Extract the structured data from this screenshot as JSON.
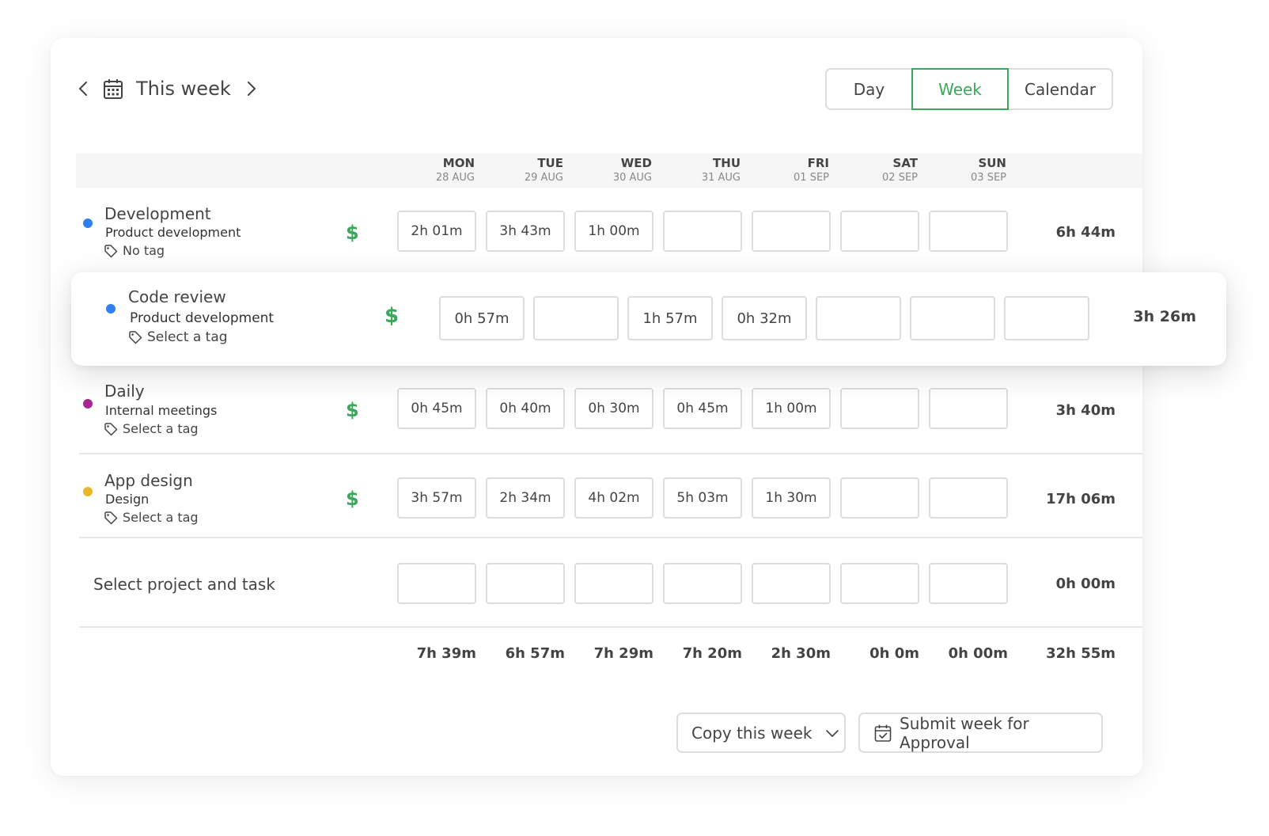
{
  "header": {
    "title": "This week",
    "views": {
      "day": "Day",
      "week": "Week",
      "calendar": "Calendar",
      "active": "week"
    }
  },
  "days": [
    {
      "name": "MON",
      "date": "28 AUG"
    },
    {
      "name": "TUE",
      "date": "29 AUG"
    },
    {
      "name": "WED",
      "date": "30 AUG"
    },
    {
      "name": "THU",
      "date": "31 AUG"
    },
    {
      "name": "FRI",
      "date": "01 SEP"
    },
    {
      "name": "SAT",
      "date": "02 SEP"
    },
    {
      "name": "SUN",
      "date": "03 SEP"
    }
  ],
  "rows": [
    {
      "task": "Development",
      "project": "Product development",
      "tag": "No tag",
      "color": "#2f7ff0",
      "billable": "$",
      "cells": [
        "2h 01m",
        "3h 43m",
        "1h 00m",
        "",
        "",
        "",
        ""
      ],
      "total": "6h 44m"
    },
    {
      "task": "Code review",
      "project": "Product development",
      "tag": "Select a tag",
      "color": "#2f7ff0",
      "billable": "$",
      "cells": [
        "0h 57m",
        "",
        "1h 57m",
        "0h 32m",
        "",
        "",
        ""
      ],
      "total": "3h 26m"
    },
    {
      "task": "Daily",
      "project": "Internal meetings",
      "tag": "Select a tag",
      "color": "#a6278f",
      "billable": "$",
      "cells": [
        "0h 45m",
        "0h 40m",
        "0h 30m",
        "0h 45m",
        "1h 00m",
        "",
        ""
      ],
      "total": "3h 40m"
    },
    {
      "task": "App design",
      "project": "Design",
      "tag": "Select a tag",
      "color": "#e8b82a",
      "billable": "$",
      "cells": [
        "3h 57m",
        "2h 34m",
        "4h 02m",
        "5h 03m",
        "1h 30m",
        "",
        ""
      ],
      "total": "17h 06m"
    }
  ],
  "new_row": {
    "label": "Select project and task",
    "cells": [
      "",
      "",
      "",
      "",
      "",
      "",
      ""
    ],
    "total": "0h 00m"
  },
  "totals": {
    "days": [
      "7h 39m",
      "6h 57m",
      "7h 29m",
      "7h 20m",
      "2h 30m",
      "0h 0m",
      "0h 00m"
    ],
    "week": "32h 55m"
  },
  "actions": {
    "copy": "Copy this week",
    "submit": "Submit week for Approval"
  },
  "colors": {
    "accent": "#3aa85a",
    "border": "#dddddd"
  },
  "icons": [
    "chevron-left-icon",
    "calendar-icon",
    "chevron-right-icon",
    "tag-icon",
    "dollar-icon",
    "chevron-down-icon",
    "calendar-check-icon"
  ]
}
